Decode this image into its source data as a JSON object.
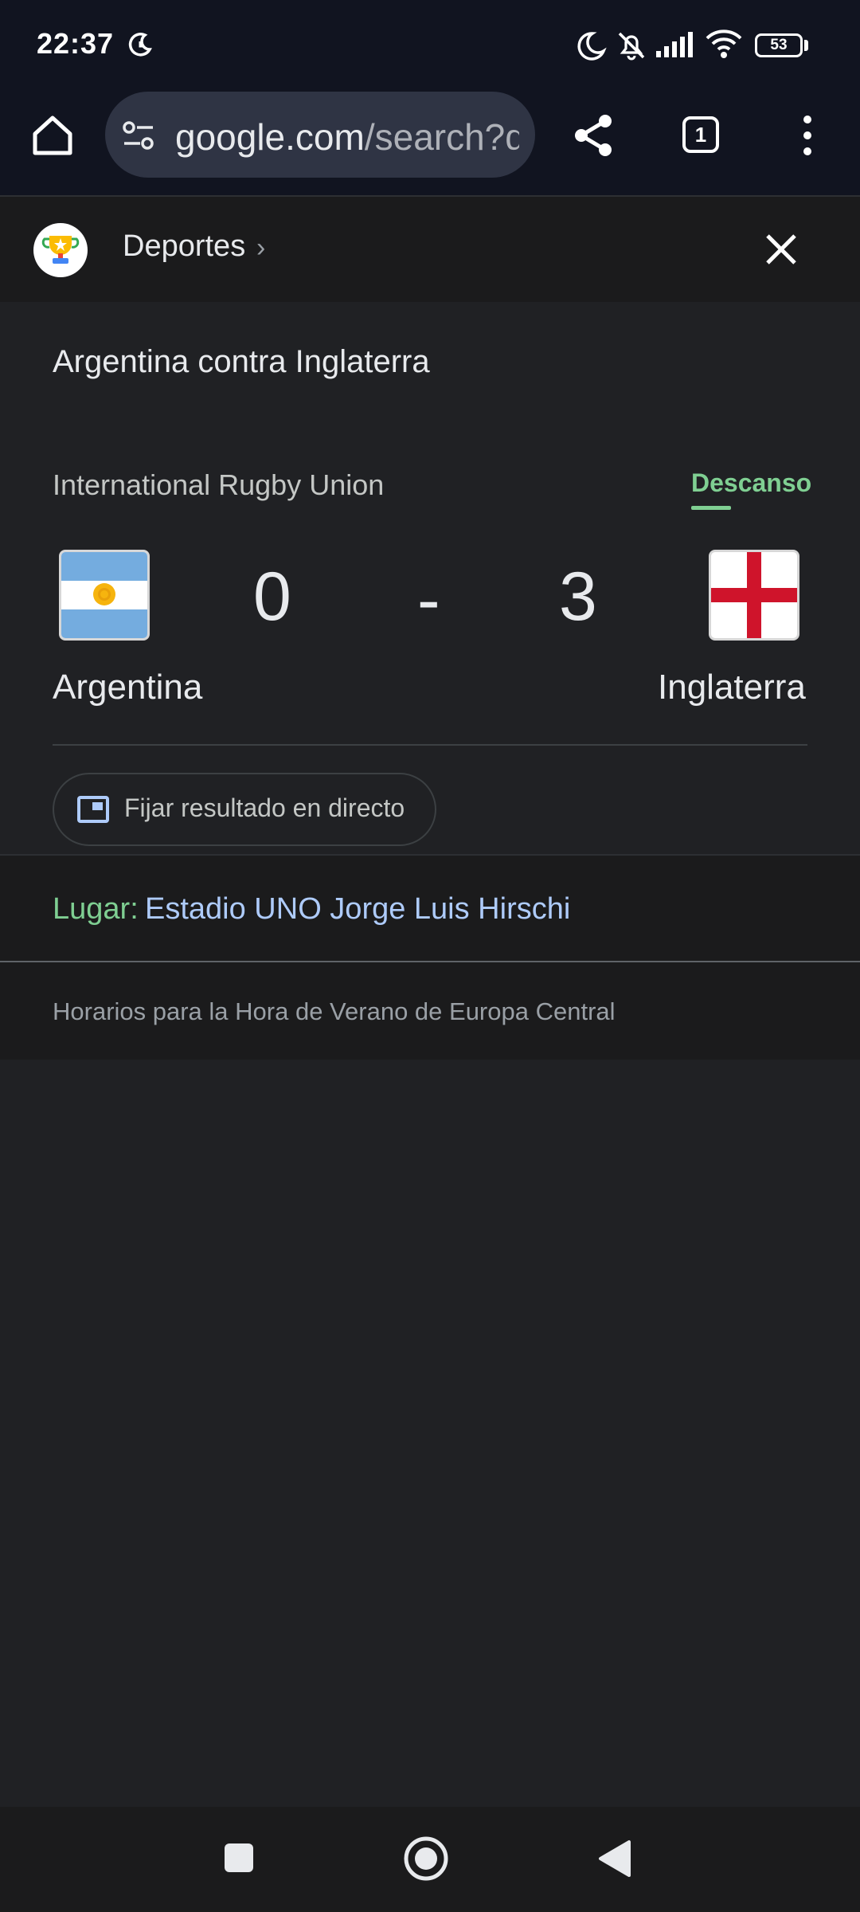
{
  "status_bar": {
    "time": "22:37",
    "battery": "53"
  },
  "toolbar": {
    "url_host": "google.com",
    "url_path": "/search?q",
    "tab_count": "1"
  },
  "sports_header": {
    "label": "Deportes",
    "chevron": "›"
  },
  "match": {
    "title": "Argentina contra Inglaterra",
    "league": "International Rugby Union",
    "status": "Descanso",
    "home_team": "Argentina",
    "away_team": "Inglaterra",
    "home_score": "0",
    "separator": "-",
    "away_score": "3",
    "pin_label": "Fijar resultado en directo"
  },
  "venue": {
    "label": "Lugar:",
    "value": "Estadio UNO Jorge Luis Hirschi"
  },
  "footnote": "Horarios para la Hora de Verano de Europa Central",
  "colors": {
    "accent_green": "#7fcf92",
    "link_blue": "#aecbfa",
    "background": "#202124",
    "england_red": "#cf142b",
    "argentina_blue": "#74acdf"
  },
  "icons": [
    "moon-clock-icon",
    "dnd-moon-icon",
    "mute-bell-icon",
    "signal-icon",
    "wifi-icon",
    "battery-icon",
    "home-icon",
    "site-settings-icon",
    "share-icon",
    "tab-switcher-icon",
    "more-vert-icon",
    "trophy-icon",
    "close-icon",
    "pin-window-icon",
    "recents-square-icon",
    "home-circle-icon",
    "back-triangle-icon"
  ]
}
